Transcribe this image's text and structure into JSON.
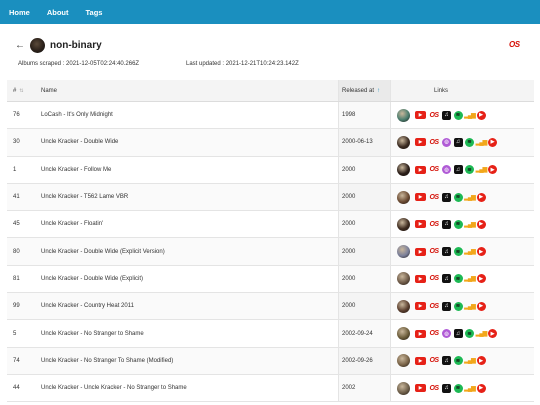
{
  "nav": {
    "items": [
      "Home",
      "About",
      "Tags"
    ]
  },
  "header": {
    "back_symbol": "←",
    "tag_name": "non-binary",
    "lastfm_logo": "OS",
    "albums_scraped_label": "Albums scraped :",
    "albums_scraped_value": "2021-12-05T02:24:40.266Z",
    "last_updated_label": "Last updated :",
    "last_updated_value": "2021-12-21T10:24:23.142Z"
  },
  "table": {
    "columns": {
      "num": "#",
      "name": "Name",
      "released": "Released at",
      "links": "Links"
    },
    "sort_icon": "⇅",
    "sort_active_icon": "↑",
    "rows": [
      {
        "num": "76",
        "name": "LoCash - It's Only Midnight",
        "released": "1998",
        "thumb": "#4a7d6e",
        "links": [
          "youtube",
          "lastfm",
          "apple-music",
          "spotify",
          "deezer",
          "youtube-music"
        ]
      },
      {
        "num": "30",
        "name": "Uncle Kracker - Double Wide",
        "released": "2000-06-13",
        "thumb": "#3a2a20",
        "links": [
          "youtube",
          "lastfm",
          "podcasts",
          "apple-music",
          "spotify",
          "deezer",
          "youtube-music"
        ]
      },
      {
        "num": "1",
        "name": "Uncle Kracker - Follow Me",
        "released": "2000",
        "thumb": "#2b1e18",
        "links": [
          "youtube",
          "lastfm",
          "podcasts",
          "apple-music",
          "spotify",
          "deezer",
          "youtube-music"
        ]
      },
      {
        "num": "41",
        "name": "Uncle Kracker - T562 Lame VBR",
        "released": "2000",
        "thumb": "#6b4a32",
        "links": [
          "youtube",
          "lastfm",
          "apple-music",
          "spotify",
          "deezer",
          "youtube-music"
        ]
      },
      {
        "num": "45",
        "name": "Uncle Kracker - Floatin'",
        "released": "2000",
        "thumb": "#3d2a1e",
        "links": [
          "youtube",
          "lastfm",
          "apple-music",
          "spotify",
          "deezer",
          "youtube-music"
        ]
      },
      {
        "num": "80",
        "name": "Uncle Kracker - Double Wide (Explicit Version)",
        "released": "2000",
        "thumb": "#7a7f9a",
        "links": [
          "youtube",
          "lastfm",
          "apple-music",
          "spotify",
          "deezer",
          "youtube-music"
        ]
      },
      {
        "num": "81",
        "name": "Uncle Kracker - Double Wide (Explicit)",
        "released": "2000",
        "thumb": "#6e5a48",
        "links": [
          "youtube",
          "lastfm",
          "apple-music",
          "spotify",
          "deezer",
          "youtube-music"
        ]
      },
      {
        "num": "99",
        "name": "Uncle Kracker - Country Heat 2011",
        "released": "2000",
        "thumb": "#5a3e2e",
        "links": [
          "youtube",
          "lastfm",
          "apple-music",
          "spotify",
          "deezer",
          "youtube-music"
        ]
      },
      {
        "num": "5",
        "name": "Uncle Kracker - No Stranger to Shame",
        "released": "2002-09-24",
        "thumb": "#6b5c3a",
        "links": [
          "youtube",
          "lastfm",
          "podcasts",
          "apple-music",
          "spotify",
          "deezer",
          "youtube-music"
        ]
      },
      {
        "num": "74",
        "name": "Uncle Kracker - No Stranger To Shame (Modified)",
        "released": "2002-09-26",
        "thumb": "#7a6448",
        "links": [
          "youtube",
          "lastfm",
          "apple-music",
          "spotify",
          "deezer",
          "youtube-music"
        ]
      },
      {
        "num": "44",
        "name": "Uncle Kracker - Uncle Kracker - No Stranger to Shame",
        "released": "2002",
        "thumb": "#6e5f4a",
        "links": [
          "youtube",
          "lastfm",
          "apple-music",
          "spotify",
          "deezer",
          "youtube-music"
        ]
      }
    ]
  },
  "icons": {
    "youtube": "▶",
    "lastfm": "OS",
    "podcasts": "◎",
    "apple-music": "♫",
    "spotify": "≋",
    "deezer": "▂▄▆",
    "youtube-music": "▶"
  }
}
